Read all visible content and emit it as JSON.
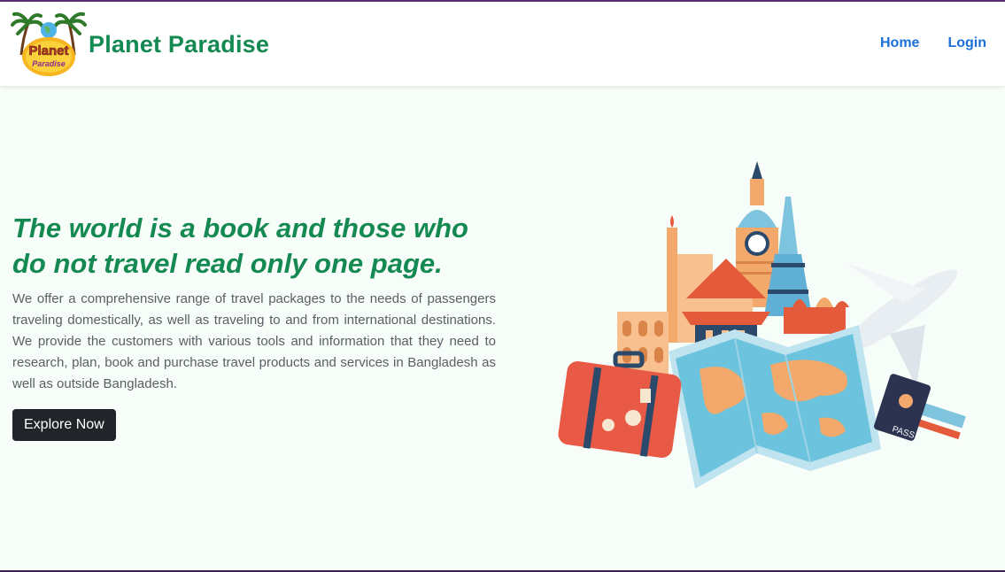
{
  "brand": {
    "name": "Planet Paradise",
    "logo_text_top": "Planet",
    "logo_text_bottom": "Paradise"
  },
  "nav": {
    "items": [
      {
        "label": "Home"
      },
      {
        "label": "Login"
      }
    ]
  },
  "hero": {
    "headline": "The world is a book and those who do not travel read only one page.",
    "description": "We offer a comprehensive range of travel packages to the needs of passengers traveling domestically, as well as traveling to and from international destinations. We provide the customers with various tools and information that they need to research, plan, book and purchase travel products and services in Bangladesh as well as outside Bangladesh.",
    "cta_label": "Explore Now",
    "illustration": {
      "passport_label": "PASS"
    }
  },
  "colors": {
    "brand_green": "#148a52",
    "nav_link_blue": "#1a6fd8",
    "button_dark": "#212529",
    "page_bg": "#f7fdf8"
  }
}
